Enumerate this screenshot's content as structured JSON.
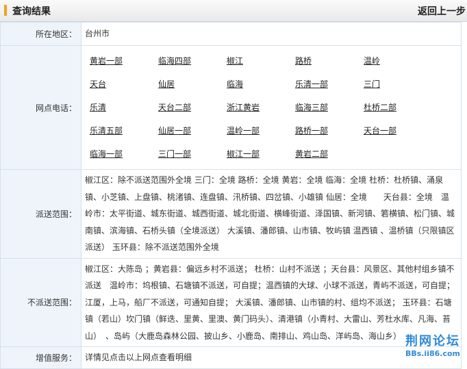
{
  "header": {
    "title": "查询结果",
    "back": "返回上一步"
  },
  "rows": {
    "area": {
      "label": "所在地区：",
      "value": "台州市"
    },
    "phones": {
      "label": "网点电话：",
      "links": [
        "黄岩一部",
        "临海四部",
        "椒江",
        "路桥",
        "温岭",
        "天台",
        "仙居",
        "临海",
        "乐清一部",
        "三门",
        "乐清",
        "天台二部",
        "浙江黄岩",
        "临海三部",
        "杜桥二部",
        "乐清五部",
        "仙居一部",
        "温岭一部",
        "路桥一部",
        "天台一部",
        "临海一部",
        "三门一部",
        "椒江一部",
        "黄岩二部"
      ]
    },
    "delivery": {
      "label": "派送范围：",
      "value": "椒江区：除不派送范围外全境 三门：全境 路桥：全境 黄岩：全境 临海：全境 杜桥：杜桥镇、涌泉镇、小芝镇、上盘镇、桃渚镇、连盘镇、汛桥镇、四岔镇、小雄镇 仙居：全境　　天台县：全境　温岭市：太平街道、城东街道、城西街道、城北街道、横峰街道、泽国镇、新河镇、箬横镇、松门镇、城南镇、滨海镇、石桥头镇（全境派送） 大溪镇、潘郎镇、山市镇、牧屿镇 温西镇 、温桥镇（只限镇区派送） 玉环县：除不派送范围外全境"
    },
    "nodelivery": {
      "label": "不派送范围：",
      "value": "椒江区：大陈岛 ；黄岩县：偏远乡村不派送； 杜桥：山村不派送 ；天台县：风景区、其他村组乡镇不派送　温岭市：坞根镇、石塘镇不派送，可自提；温西镇的大球、小球不派送，青屿不派送，可自提；江厦，上马，船厂不派送，可通知自提； 大溪镇、潘郎镇、山市镇的村、组均不派送； 玉环县：石塘镇（若山）坎门镇（鲜迭、里黄、里澳、黄门码头）、清港镇（小青村、大雷山、芳杜水库、凡海、苔山）　、岛屿（大鹿岛森林公园、披山乡、小鹿岛、南排山、鸡山岛、洋屿岛、海山乡）"
    },
    "service": {
      "label": "增值服务：",
      "value": "详情见点击以上网点查看明细"
    }
  },
  "watermark": {
    "title": "荆网论坛",
    "url": "BBs.ii86.com"
  },
  "colors": {
    "accent": "#f0a020",
    "label_bg": "#eef4fa",
    "border": "#d4e0ec",
    "watermark": "#2f8ad6"
  }
}
